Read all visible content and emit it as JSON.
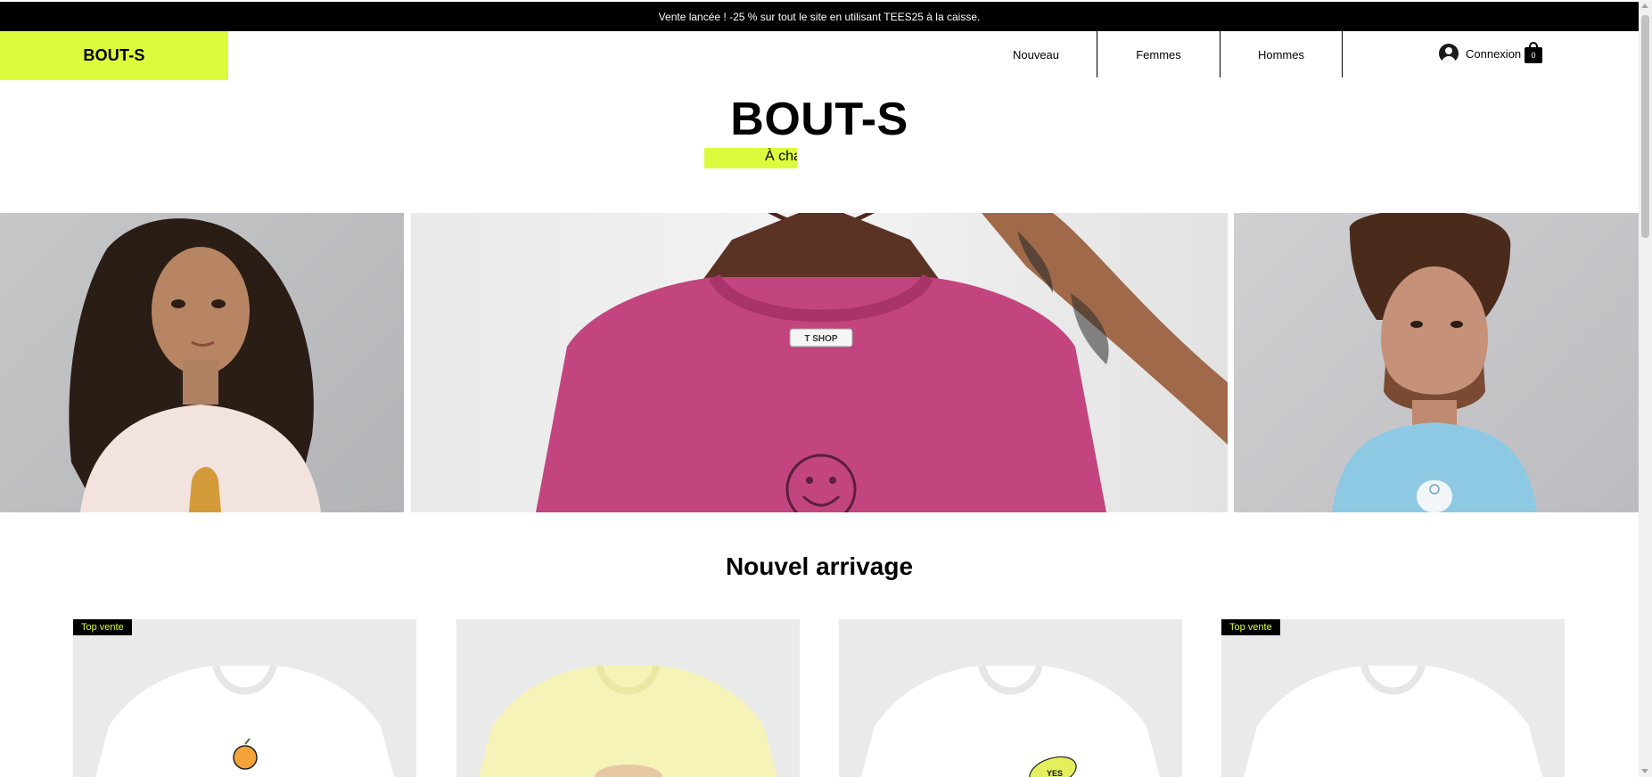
{
  "announcement": {
    "text": "Vente lancée ! -25 %  sur tout le site en utilisant TEES25 à la caisse."
  },
  "header": {
    "logo": "BOUT-S",
    "nav": [
      "Nouveau",
      "Femmes",
      "Hommes"
    ],
    "login_label": "Connexion",
    "cart_count": "0"
  },
  "hero": {
    "title": "BOUT-S",
    "tagline": "À cha"
  },
  "hero_images": {
    "center_tag": "T SHOP"
  },
  "section": {
    "title": "Nouvel arrivage"
  },
  "products": [
    {
      "badge": "Top vente",
      "shirt_color": "#ffffff"
    },
    {
      "badge": "",
      "shirt_color": "#f6f3b8"
    },
    {
      "badge": "",
      "shirt_color": "#ffffff",
      "print_text": "YES"
    },
    {
      "badge": "Top vente",
      "shirt_color": "#ffffff"
    }
  ],
  "colors": {
    "accent": "#dcfb3c",
    "announcement_bg": "#000000",
    "card_bg": "#eaeaea"
  }
}
